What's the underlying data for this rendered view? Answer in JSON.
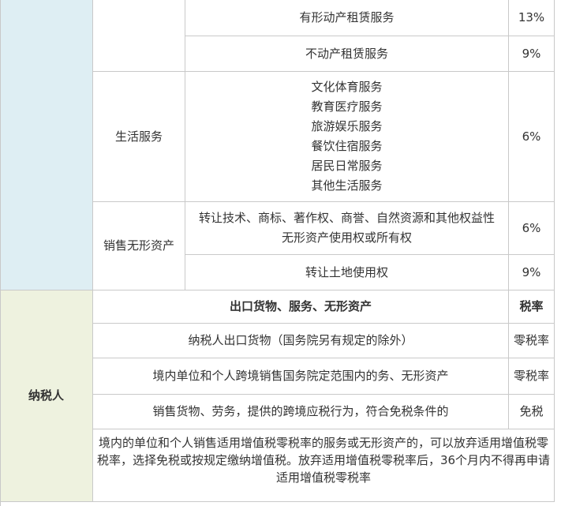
{
  "upper": {
    "rows": [
      {
        "item": "有形动产租赁服务",
        "rate": "13%"
      },
      {
        "item": "不动产租赁服务",
        "rate": "9%"
      }
    ],
    "life_services": {
      "category": "生活服务",
      "items": [
        "文化体育服务",
        "教育医疗服务",
        "旅游娱乐服务",
        "餐饮住宿服务",
        "居民日常服务",
        "其他生活服务"
      ],
      "rate": "6%"
    },
    "intangible": {
      "category": "销售无形资产",
      "rows": [
        {
          "item_lines": [
            "转让技术、商标、著作权、商誉、自然资源和其他权益性",
            "无形资产使用权或所有权"
          ],
          "rate": "6%"
        },
        {
          "item_lines": [
            "转让土地使用权"
          ],
          "rate": "9%"
        }
      ]
    }
  },
  "lower": {
    "group_label": "纳税人",
    "header": {
      "item": "出口货物、服务、无形资产",
      "rate": "税率"
    },
    "rows": [
      {
        "item": "纳税人出口货物（国务院另有规定的除外）",
        "rate": "零税率"
      },
      {
        "item": "境内单位和个人跨境销售国务院定范围内的务、无形资产",
        "rate": "零税率"
      },
      {
        "item": "销售货物、劳务，提供的跨境应税行为，符合免税条件的",
        "rate": "免税"
      }
    ],
    "note": "境内的单位和个人销售适用增值税零税率的服务或无形资产的，可以放弃适用增值税零税率，选择免税或按规定缴纳增值税。放弃适用增值税零税率后，36个月内不得再申请适用增值税零税率"
  }
}
